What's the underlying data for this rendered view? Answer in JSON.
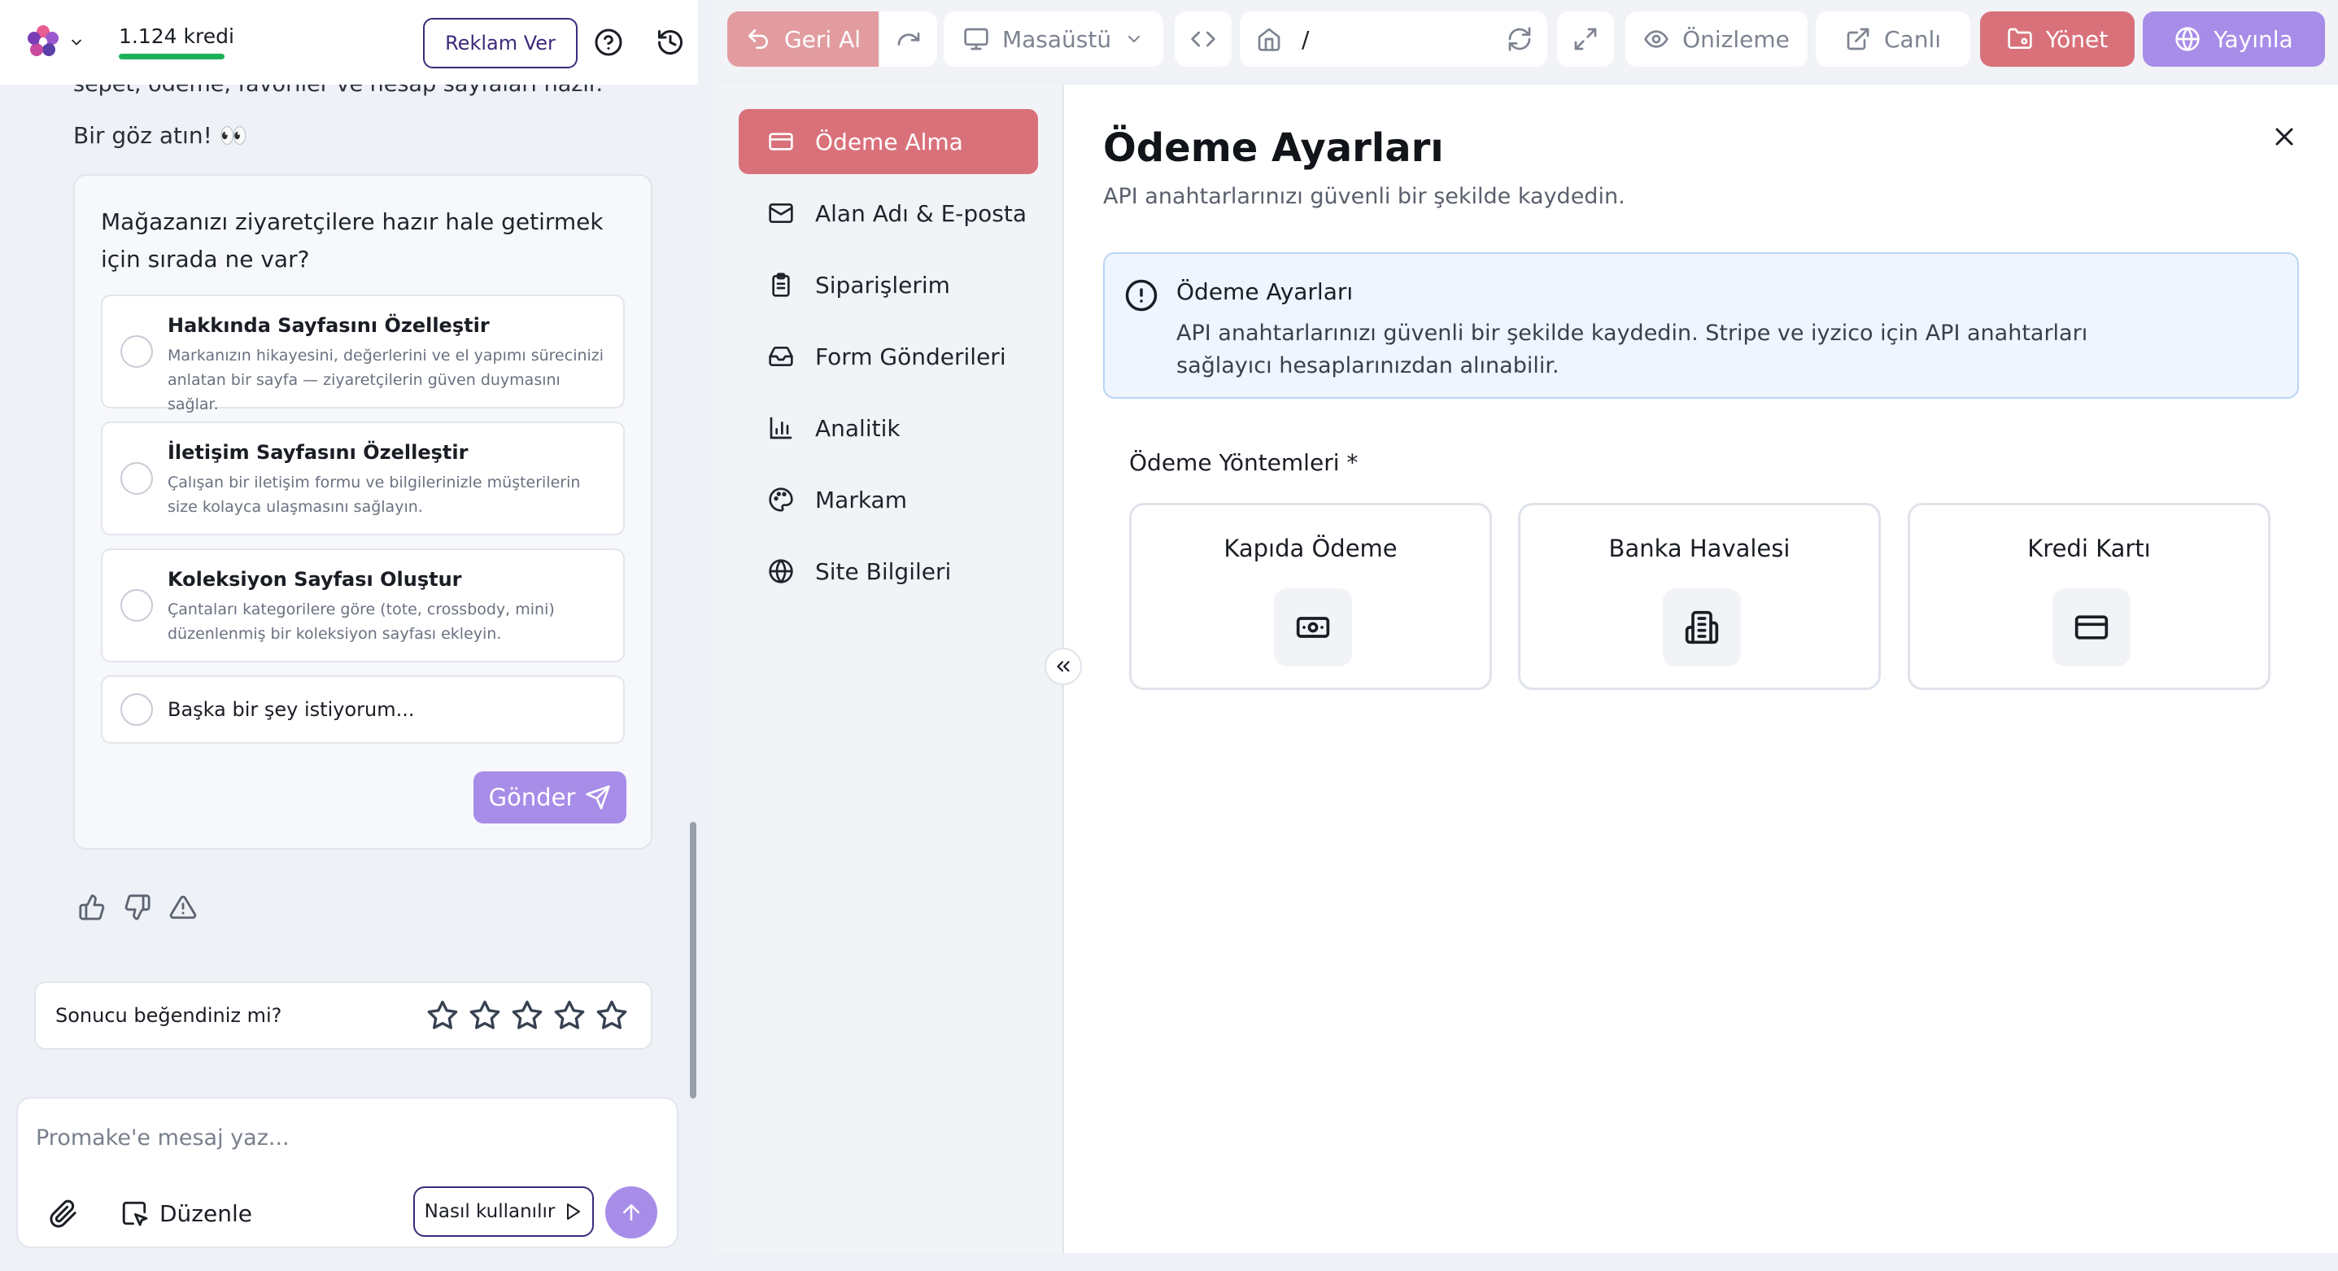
{
  "chat": {
    "header": {
      "credits": "1.124 kredi",
      "ad_button": "Reklam Ver"
    },
    "cut_text": "sepet, ödeme, favoriler ve hesap sayfaları hazır.",
    "look_text": "Bir göz atın! 👀",
    "question_card": {
      "question": "Mağazanızı ziyaretçilere hazır hale getirmek için sırada ne var?",
      "options": [
        {
          "title": "Hakkında Sayfasını Özelleştir",
          "desc": "Markanızın hikayesini, değerlerini ve el yapımı sürecinizi anlatan bir sayfa — ziyaretçilerin güven duymasını sağlar."
        },
        {
          "title": "İletişim Sayfasını Özelleştir",
          "desc": "Çalışan bir iletişim formu ve bilgilerinizle müşterilerin size kolayca ulaşmasını sağlayın."
        },
        {
          "title": "Koleksiyon Sayfası Oluştur",
          "desc": "Çantaları kategorilere göre (tote, crossbody, mini) düzenlenmiş bir koleksiyon sayfası ekleyin."
        },
        {
          "title": "Başka bir şey istiyorum...",
          "desc": ""
        }
      ],
      "send_button": "Gönder"
    },
    "rating": {
      "question": "Sonucu beğendiniz mi?",
      "stars": 5,
      "selected": 0
    },
    "composer": {
      "placeholder": "Promake'e mesaj yaz...",
      "edit_button": "Düzenle",
      "howto_button": "Nasıl kullanılır"
    }
  },
  "toolbar": {
    "undo": "Geri Al",
    "device": "Masaüstü",
    "url_path": "/",
    "preview": "Önizleme",
    "live": "Canlı",
    "manage": "Yönet",
    "publish": "Yayınla"
  },
  "settings": {
    "nav": [
      {
        "label": "Ödeme Alma",
        "icon": "credit-card-icon",
        "active": true
      },
      {
        "label": "Alan Adı & E-posta",
        "icon": "mail-icon",
        "active": false
      },
      {
        "label": "Siparişlerim",
        "icon": "clipboard-icon",
        "active": false
      },
      {
        "label": "Form Gönderileri",
        "icon": "inbox-icon",
        "active": false
      },
      {
        "label": "Analitik",
        "icon": "bar-chart-icon",
        "active": false
      },
      {
        "label": "Markam",
        "icon": "palette-icon",
        "active": false
      },
      {
        "label": "Site Bilgileri",
        "icon": "globe-icon",
        "active": false
      }
    ],
    "title": "Ödeme Ayarları",
    "subtitle": "API anahtarlarınızı güvenli bir şekilde kaydedin.",
    "info": {
      "title": "Ödeme Ayarları",
      "body": "API anahtarlarınızı güvenli bir şekilde kaydedin. Stripe ve iyzico için API anahtarları sağlayıcı hesaplarınızdan alınabilir."
    },
    "payment_methods_label": "Ödeme Yöntemleri *",
    "payment_methods": [
      {
        "label": "Kapıda Ödeme",
        "icon": "cash-icon"
      },
      {
        "label": "Banka Havalesi",
        "icon": "bank-building-icon"
      },
      {
        "label": "Kredi Kartı",
        "icon": "credit-card-icon"
      }
    ]
  },
  "colors": {
    "accent_purple": "#a88de8",
    "manage_red": "#d9717a",
    "undo_pink": "#e29ca0",
    "credits_green": "#1fb15a",
    "info_bg": "#eef5ff"
  }
}
